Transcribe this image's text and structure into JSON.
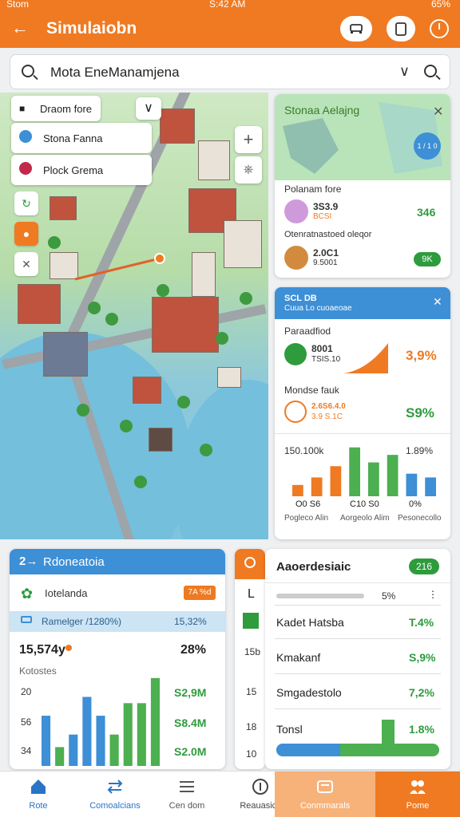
{
  "status": {
    "carrier": "Stom",
    "time": "S:42 AM",
    "battery": "65%"
  },
  "header": {
    "back_icon": "arrow-left-icon",
    "title": "Simulaiobn"
  },
  "search": {
    "value": "Mota EneManamjena"
  },
  "map": {
    "filter_label": "Draom fore",
    "layer_1": "Stona Fanna",
    "layer_2": "Plock Grema"
  },
  "card_map": {
    "title": "Stonaa Aelajng",
    "badge": "1 / 1 0",
    "row_label": "Polanam fore",
    "item1_value": "3S3.9",
    "item1_sub": "BCSI",
    "item1_score": "346",
    "row2_label": "Otenratnastoed oleqor",
    "item2_value": "2.0C1",
    "item2_sub": "9.5001",
    "item2_badge": "9K"
  },
  "card_blue": {
    "title": "SCL DB",
    "subtitle": "Cuua Lo cuoaeoae",
    "row1_label": "Paraadfiod",
    "row1_value": "8001",
    "row1_sub": "TSIS.10",
    "row1_pct": "3,9%",
    "row2_label": "Mondse fauk",
    "row2_value": "2.6S6.4.0",
    "row2_sub": "3.9 S.1C",
    "row2_pct": "S9%",
    "chart_left": "150.100k",
    "chart_right": "1.89%",
    "bars": [
      {
        "v": 1.5,
        "c": "#ef7a22"
      },
      {
        "v": 2.5,
        "c": "#ef7a22"
      },
      {
        "v": 4.0,
        "c": "#ef7a22"
      },
      {
        "v": 6.5,
        "c": "#4caf50"
      },
      {
        "v": 4.5,
        "c": "#4caf50"
      },
      {
        "v": 5.5,
        "c": "#4caf50"
      },
      {
        "v": 3.0,
        "c": "#3d8fd6"
      },
      {
        "v": 2.5,
        "c": "#3d8fd6"
      }
    ],
    "ticks": [
      "O0 S6",
      "C10 S0",
      "0%"
    ],
    "ticklabels": [
      "Pogleco Alin",
      "Aorgeolo Alim",
      "Pesonecollo"
    ]
  },
  "card_left": {
    "title": "Rdoneatoia",
    "row_label": "Iotelanda",
    "row_badge": "7A %d",
    "band_label": "Ramelger /1280%)",
    "band_value": "15,32%",
    "big": "15,574y",
    "big_pct": "28%",
    "sub": "Kotostes",
    "yticks": [
      "20",
      "56",
      "34"
    ],
    "values": [
      "S2,9M",
      "S8.4M",
      "S2.0M"
    ],
    "bars": [
      {
        "v": 4.0,
        "c": "#3d8fd6"
      },
      {
        "v": 1.5,
        "c": "#4caf50"
      },
      {
        "v": 2.5,
        "c": "#3d8fd6"
      },
      {
        "v": 5.5,
        "c": "#3d8fd6"
      },
      {
        "v": 4.0,
        "c": "#3d8fd6"
      },
      {
        "v": 2.5,
        "c": "#4caf50"
      },
      {
        "v": 5.0,
        "c": "#4caf50"
      },
      {
        "v": 5.0,
        "c": "#4caf50"
      },
      {
        "v": 7.0,
        "c": "#4caf50"
      }
    ]
  },
  "card_mid": {
    "label": "L",
    "yticks": [
      "15b",
      "15",
      "18",
      "10"
    ]
  },
  "card_right": {
    "title": "Aaoerdesiaic",
    "badge": "216",
    "bar_pct": "5%",
    "rows": [
      {
        "label": "Kadet Hatsba",
        "value": "T.4%"
      },
      {
        "label": "Kmakanf",
        "value": "S,9%"
      },
      {
        "label": "Smgadestolo",
        "value": "7,2%"
      },
      {
        "label": "Tonsl",
        "value": "1.8%"
      }
    ]
  },
  "nav": [
    {
      "label": "Rote",
      "icon": "home-icon"
    },
    {
      "label": "Comoalcians",
      "icon": "swap-icon"
    },
    {
      "label": "Cen dom",
      "icon": "menu-icon"
    },
    {
      "label": "Reauasicc",
      "icon": "info-icon"
    },
    {
      "label": "Conmmarals",
      "icon": "tray-icon"
    },
    {
      "label": "Pome",
      "icon": "people-icon"
    }
  ]
}
